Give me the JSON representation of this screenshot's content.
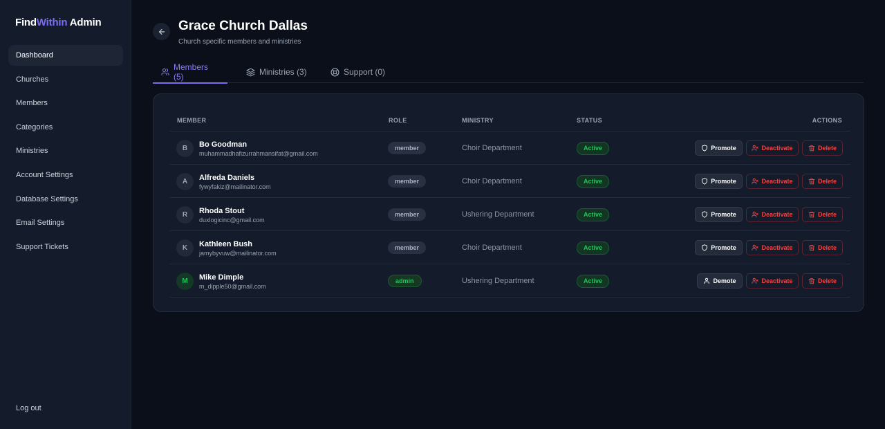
{
  "brand": {
    "part1": "Find",
    "part2": "Within",
    "part3": "Admin"
  },
  "sidebar": {
    "items": [
      {
        "label": "Dashboard"
      },
      {
        "label": "Churches"
      },
      {
        "label": "Members"
      },
      {
        "label": "Categories"
      },
      {
        "label": "Ministries"
      },
      {
        "label": "Account Settings"
      },
      {
        "label": "Database Settings"
      },
      {
        "label": "Email Settings"
      },
      {
        "label": "Support Tickets"
      }
    ],
    "logout": "Log out"
  },
  "header": {
    "title": "Grace Church Dallas",
    "subtitle": "Church specific members and ministries"
  },
  "tabs": [
    {
      "label": "Members (5)",
      "icon": "users-icon"
    },
    {
      "label": "Ministries (3)",
      "icon": "layers-icon"
    },
    {
      "label": "Support (0)",
      "icon": "lifebuoy-icon"
    }
  ],
  "table": {
    "headers": {
      "member": "MEMBER",
      "role": "ROLE",
      "ministry": "MINISTRY",
      "status": "STATUS",
      "actions": "ACTIONS"
    },
    "rows": [
      {
        "initial": "B",
        "name": "Bo Goodman",
        "email": "muhammadhafizurrahmansifat@gmail.com",
        "role": "member",
        "ministry": "Choir Department",
        "status": "Active",
        "primary_action": "Promote"
      },
      {
        "initial": "A",
        "name": "Alfreda Daniels",
        "email": "fywyfakiz@mailinator.com",
        "role": "member",
        "ministry": "Choir Department",
        "status": "Active",
        "primary_action": "Promote"
      },
      {
        "initial": "R",
        "name": "Rhoda Stout",
        "email": "duxlogicinc@gmail.com",
        "role": "member",
        "ministry": "Ushering Department",
        "status": "Active",
        "primary_action": "Promote"
      },
      {
        "initial": "K",
        "name": "Kathleen Bush",
        "email": "jamybyvuw@mailinator.com",
        "role": "member",
        "ministry": "Choir Department",
        "status": "Active",
        "primary_action": "Promote"
      },
      {
        "initial": "M",
        "name": "Mike Dimple",
        "email": "m_dipple50@gmail.com",
        "role": "admin",
        "ministry": "Ushering Department",
        "status": "Active",
        "primary_action": "Demote"
      }
    ],
    "deactivate_label": "Deactivate",
    "delete_label": "Delete"
  },
  "colors": {
    "accent": "#7c6cf2",
    "success": "#22c55e",
    "danger": "#ef4444",
    "background": "#0b0f19",
    "panel": "#141b2b"
  }
}
